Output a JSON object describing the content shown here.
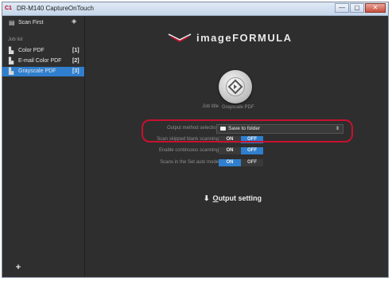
{
  "window": {
    "title": "DR-M140 CaptureOnTouch",
    "app_icon_text": "C1",
    "minimize": "—",
    "maximize": "▢",
    "close": "✕"
  },
  "sidebar": {
    "scan_first": {
      "label": "Scan First"
    },
    "job_list_heading": "Job list",
    "items": [
      {
        "label": "Color PDF",
        "count": "[1]",
        "selected": false
      },
      {
        "label": "E-mail Color PDF",
        "count": "[2]",
        "selected": false
      },
      {
        "label": "Grayscale PDF",
        "count": "[3]",
        "selected": true
      }
    ],
    "add_label": "+"
  },
  "main": {
    "logo_text": "imageFORMULA",
    "job_title_label": "Job title",
    "job_title_value": "Grayscale PDF",
    "output_method": {
      "label": "Output method selection",
      "value": "Save to folder"
    },
    "options": [
      {
        "label": "Scan skipped blank scanning",
        "on": "ON",
        "off": "OFF",
        "state": "off"
      },
      {
        "label": "Enable continuous scanning",
        "on": "ON",
        "off": "OFF",
        "state": "off"
      },
      {
        "label": "Scans in the Set auto mode",
        "on": "ON",
        "off": "OFF",
        "state": "on"
      }
    ],
    "output_setting": {
      "prefix": "",
      "underlined": "O",
      "rest": "utput setting"
    }
  },
  "colors": {
    "accent": "#2f7fce",
    "highlight": "#c8102e",
    "background": "#2e2e2e"
  }
}
